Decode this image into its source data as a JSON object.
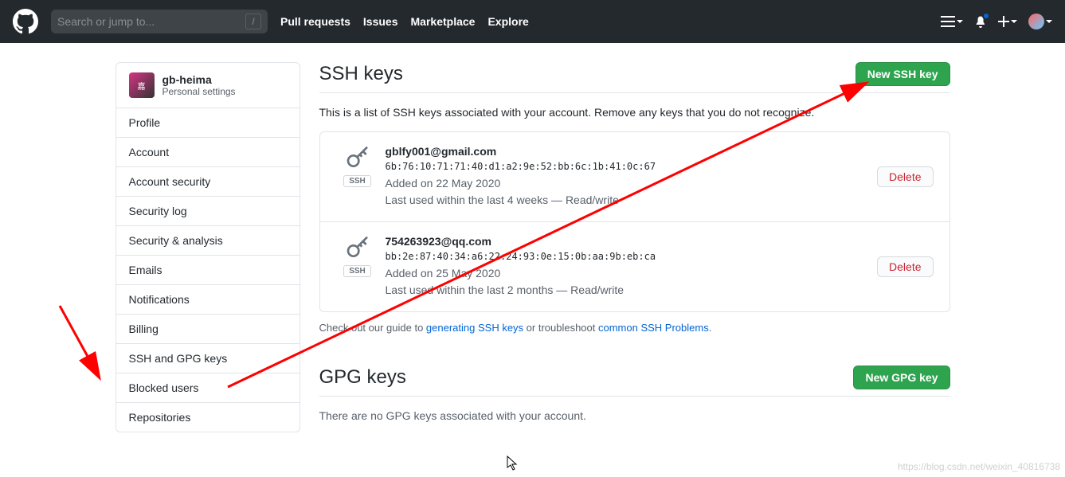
{
  "header": {
    "search_placeholder": "Search or jump to...",
    "slash": "/",
    "nav": {
      "pull_requests": "Pull requests",
      "issues": "Issues",
      "marketplace": "Marketplace",
      "explore": "Explore"
    }
  },
  "sidebar": {
    "username": "gb-heima",
    "subtitle": "Personal settings",
    "items": [
      "Profile",
      "Account",
      "Account security",
      "Security log",
      "Security & analysis",
      "Emails",
      "Notifications",
      "Billing",
      "SSH and GPG keys",
      "Blocked users",
      "Repositories"
    ]
  },
  "ssh": {
    "title": "SSH keys",
    "new_btn": "New SSH key",
    "desc": "This is a list of SSH keys associated with your account. Remove any keys that you do not recognize.",
    "badge": "SSH",
    "delete": "Delete",
    "keys": [
      {
        "title": "gblfy001@gmail.com",
        "fingerprint": "6b:76:10:71:71:40:d1:a2:9e:52:bb:6c:1b:41:0c:67",
        "added": "Added on 22 May 2020",
        "last": "Last used within the last 4 weeks — Read/write"
      },
      {
        "title": "754263923@qq.com",
        "fingerprint": "bb:2e:87:40:34:a6:22:24:93:0e:15:0b:aa:9b:eb:ca",
        "added": "Added on 25 May 2020",
        "last": "Last used within the last 2 months — Read/write"
      }
    ],
    "guide_prefix": "Check out our guide to ",
    "guide_link1": "generating SSH keys",
    "guide_mid": " or troubleshoot ",
    "guide_link2": "common SSH Problems",
    "guide_suffix": "."
  },
  "gpg": {
    "title": "GPG keys",
    "new_btn": "New GPG key",
    "empty": "There are no GPG keys associated with your account."
  },
  "watermark": "https://blog.csdn.net/weixin_40816738"
}
